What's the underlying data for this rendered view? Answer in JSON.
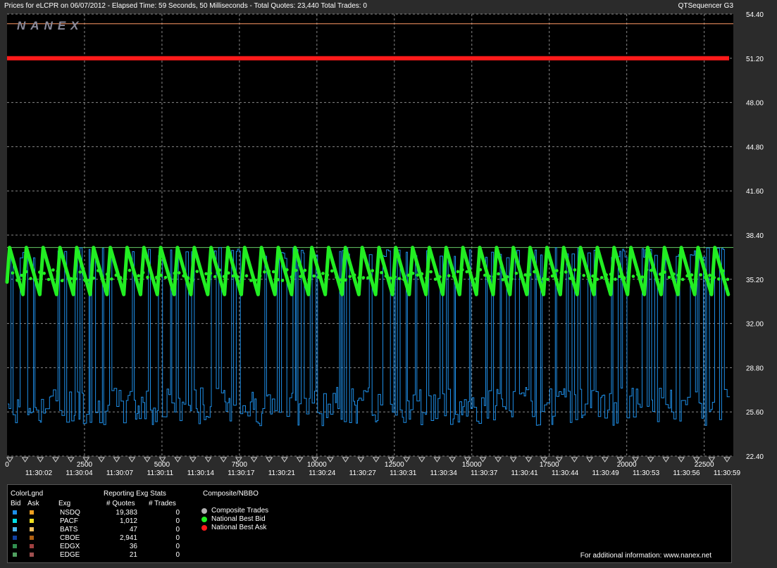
{
  "header": {
    "title": "Prices for  eLCPR  on  06/07/2012  -  Elapsed Time: 59 Seconds, 50 Milliseconds  -  Total Quotes: 23,440  Total Trades: 0",
    "brand": "QTSequencer G3",
    "logo_text": "NANEX"
  },
  "chart_data": {
    "type": "line",
    "y_ticks": [
      "54.40",
      "51.20",
      "48.00",
      "44.80",
      "41.60",
      "38.40",
      "35.20",
      "32.00",
      "28.80",
      "25.60",
      "22.40"
    ],
    "ylim": [
      22.4,
      54.4
    ],
    "x_seq_ticks": [
      "0",
      "2500",
      "5000",
      "7500",
      "10000",
      "12500",
      "15000",
      "17500",
      "20000",
      "22500"
    ],
    "x_time_ticks": [
      "11:30:02",
      "11:30:04",
      "11:30:07",
      "11:30:11",
      "11:30:14",
      "11:30:17",
      "11:30:21",
      "11:30:24",
      "11:30:27",
      "11:30:31",
      "11:30:34",
      "11:30:37",
      "11:30:41",
      "11:30:44",
      "11:30:49",
      "11:30:53",
      "11:30:56",
      "11:30:59"
    ],
    "xlim": [
      0,
      23440
    ],
    "grid": true,
    "series": [
      {
        "name": "National Best Ask",
        "color": "#ff1a1a",
        "level": 51.2
      },
      {
        "name": "National Best Bid",
        "color": "#22ee22",
        "range": [
          34.1,
          37.5
        ]
      },
      {
        "name": "NSDQ",
        "color": "#1e8fe8",
        "range": [
          24.6,
          37.5
        ]
      }
    ],
    "reference_lines": [
      {
        "level": 53.7,
        "color": "#ff9966"
      },
      {
        "level": 37.5,
        "color": "#66cc66"
      }
    ]
  },
  "legend": {
    "color_title": "ColorLgnd",
    "bid_label": "Bid",
    "ask_label": "Ask",
    "stats_title": "Reporting Exg Stats",
    "exg_header": "Exg",
    "quotes_header": "# Quotes",
    "trades_header": "# Trades",
    "exchanges": [
      {
        "name": "NSDQ",
        "quotes": "19,383",
        "trades": "0",
        "bid_color": "#1e8fe8",
        "ask_color": "#f0a020"
      },
      {
        "name": "PACF",
        "quotes": "1,012",
        "trades": "0",
        "bid_color": "#00e0e8",
        "ask_color": "#f0e020"
      },
      {
        "name": "BATS",
        "quotes": "47",
        "trades": "0",
        "bid_color": "#50b8f0",
        "ask_color": "#f0c060"
      },
      {
        "name": "CBOE",
        "quotes": "2,941",
        "trades": "0",
        "bid_color": "#1040a0",
        "ask_color": "#b06010"
      },
      {
        "name": "EDGX",
        "quotes": "36",
        "trades": "0",
        "bid_color": "#309050",
        "ask_color": "#a04040"
      },
      {
        "name": "EDGE",
        "quotes": "21",
        "trades": "0",
        "bid_color": "#50a060",
        "ask_color": "#a05050"
      }
    ],
    "composite_title": "Composite/NBBO",
    "composite_items": [
      {
        "label": "Composite Trades",
        "color": "#b0b0b0"
      },
      {
        "label": "National Best Bid",
        "color": "#22ee22"
      },
      {
        "label": "National Best Ask",
        "color": "#ff1a1a"
      }
    ],
    "footer": "For additional information: www.nanex.net"
  }
}
